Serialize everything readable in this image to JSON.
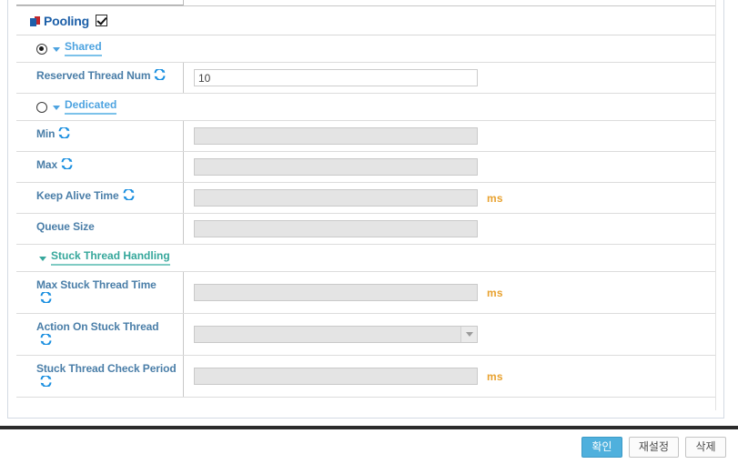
{
  "panel": {
    "section": {
      "title": "Pooling",
      "icon": "pooling-blocks-icon",
      "checkbox_checked": true
    },
    "groups": [
      {
        "id": "shared",
        "label": "Shared",
        "radio_selected": true,
        "color": "#4da3e0",
        "fields": [
          {
            "label": "Reserved Thread Num",
            "has_sync_icon": true,
            "control": "text",
            "value": "10",
            "disabled": false,
            "unit": ""
          }
        ]
      },
      {
        "id": "dedicated",
        "label": "Dedicated",
        "radio_selected": false,
        "color": "#4da3e0",
        "fields": [
          {
            "label": "Min",
            "has_sync_icon": true,
            "control": "text",
            "value": "",
            "disabled": true,
            "unit": ""
          },
          {
            "label": "Max",
            "has_sync_icon": true,
            "control": "text",
            "value": "",
            "disabled": true,
            "unit": ""
          },
          {
            "label": "Keep Alive Time",
            "has_sync_icon": true,
            "control": "text",
            "value": "",
            "disabled": true,
            "unit": "ms"
          },
          {
            "label": "Queue Size",
            "has_sync_icon": false,
            "control": "text",
            "value": "",
            "disabled": true,
            "unit": ""
          }
        ]
      },
      {
        "id": "stuck-thread-handling",
        "label": "Stuck Thread Handling",
        "radio_selected": null,
        "color": "#35a79b",
        "fields": [
          {
            "label": "Max Stuck Thread Time",
            "has_sync_icon": true,
            "control": "text",
            "value": "",
            "disabled": true,
            "unit": "ms"
          },
          {
            "label": "Action On Stuck Thread",
            "has_sync_icon": true,
            "control": "select",
            "value": "",
            "disabled": true,
            "unit": ""
          },
          {
            "label": "Stuck Thread Check Period",
            "has_sync_icon": true,
            "control": "text",
            "value": "",
            "disabled": true,
            "unit": "ms"
          }
        ]
      }
    ]
  },
  "footer": {
    "confirm_label": "확인",
    "reset_label": "재설정",
    "delete_label": "삭제"
  },
  "colors": {
    "section_title": "#1c5fa8",
    "group_blue": "#4da3e0",
    "group_teal": "#35a79b",
    "field_label": "#4a7ea8",
    "unit_orange": "#e8a230",
    "primary_button": "#4fb0dd",
    "divider": "#2b2b2b"
  }
}
